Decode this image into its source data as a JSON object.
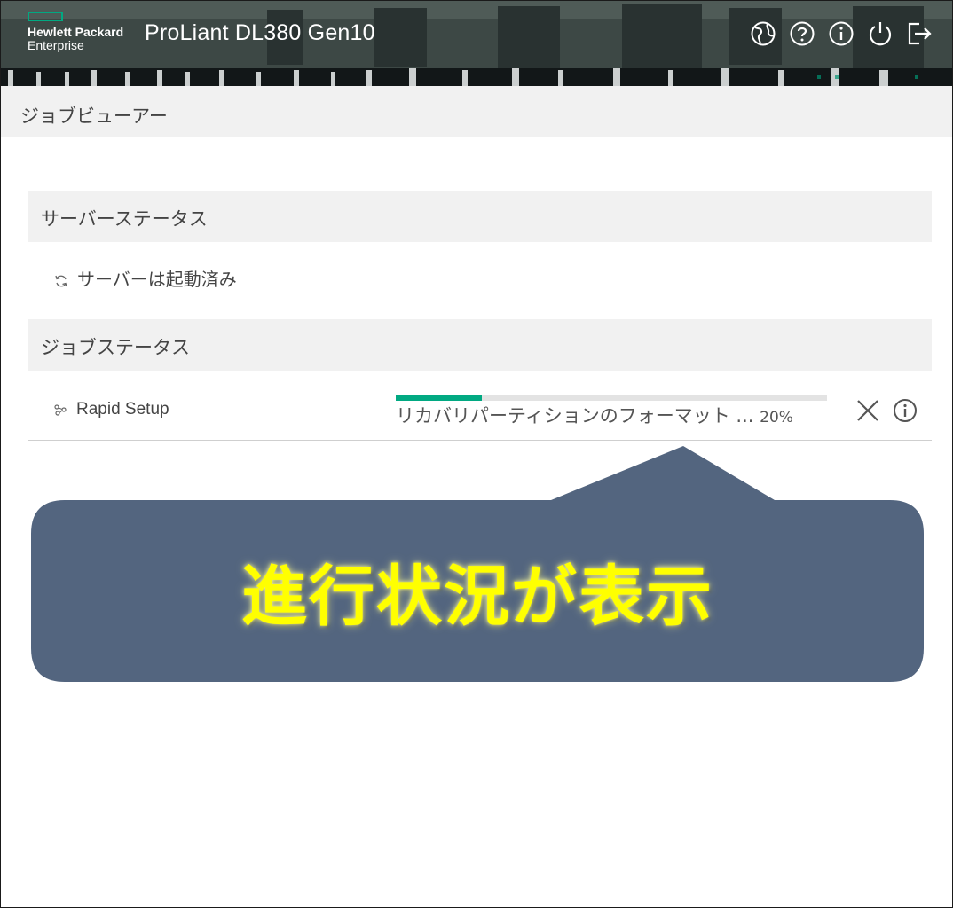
{
  "header": {
    "brand_line1": "Hewlett Packard",
    "brand_line2": "Enterprise",
    "product": "ProLiant DL380 Gen10",
    "icons": [
      "globe-icon",
      "help-icon",
      "info-icon",
      "power-icon",
      "logout-icon"
    ],
    "accent_color": "#01a982"
  },
  "page": {
    "title": "ジョブビューアー"
  },
  "server_section": {
    "title": "サーバーステータス",
    "status": "サーバーは起動済み",
    "status_icon": "refresh-icon"
  },
  "job_section": {
    "title": "ジョブステータス",
    "jobs": [
      {
        "name": "Rapid Setup",
        "icon": "nodes-icon",
        "progress_label": "リカバリパーティションのフォーマット ...",
        "progress_percent_text": "20%",
        "progress_fraction": 0.2,
        "actions": [
          "cancel-icon",
          "info-icon"
        ]
      }
    ]
  },
  "callout": {
    "text": "進行状況が表示",
    "background": "#53657f",
    "text_color": "#ffff00"
  }
}
